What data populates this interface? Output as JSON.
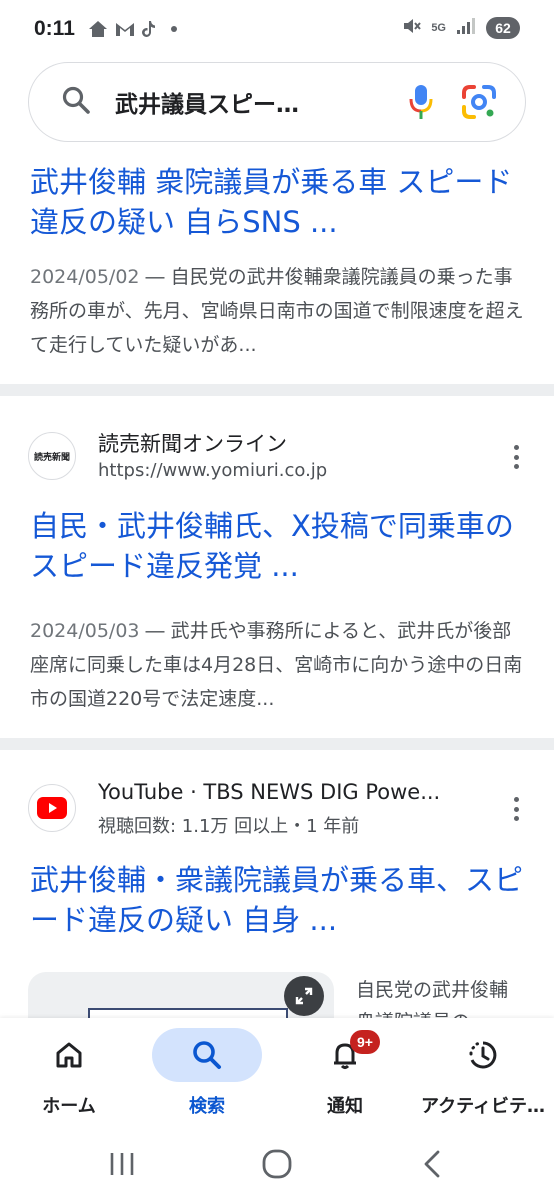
{
  "status_bar": {
    "time": "0:11",
    "network": "5G",
    "battery": "62"
  },
  "search": {
    "query": "武井議員スピー…",
    "icons": [
      "search-icon",
      "mic-icon",
      "lens-icon"
    ]
  },
  "results": [
    {
      "title": "武井俊輔 衆院議員が乗る車 スピード違反の疑い 自らSNS ...",
      "date": "2024/05/02",
      "snippet": " ― 自民党の武井俊輔衆議院議員の乗った事務所の車が、先月、宮崎県日南市の国道で制限速度を超えて走行していた疑いがあ..."
    },
    {
      "site_name": "読売新聞オンライン",
      "site_url": "https://www.yomiuri.co.jp",
      "favicon_text": "読売新聞",
      "title": "自民・武井俊輔氏、X投稿で同乗車のスピード違反発覚 ...",
      "date": "2024/05/03",
      "snippet": " ― 武井氏や事務所によると、武井氏が後部座席に同乗した車は4月28日、宮崎市に向かう途中の日南市の国道220号で法定速度..."
    },
    {
      "site_name": "YouTube · TBS NEWS DIG Powe...",
      "site_meta": "視聴回数: 1.1万 回以上・1 年前",
      "title": "武井俊輔・衆議院議員が乗る車、スピード違反の疑い 自身 ...",
      "side_text": "自民党の武井俊輔衆議院議員の"
    }
  ],
  "bottom_nav": {
    "items": [
      {
        "label": "ホーム",
        "icon": "home-icon"
      },
      {
        "label": "検索",
        "icon": "search-icon"
      },
      {
        "label": "通知",
        "icon": "bell-icon",
        "badge": "9+"
      },
      {
        "label": "アクティビテ…",
        "icon": "activity-icon"
      }
    ],
    "active_index": 1
  },
  "colors": {
    "link": "#1558d6",
    "active_pill": "#d3e3fd",
    "active_label": "#0b57d0",
    "badge": "#c5221f",
    "youtube_red": "#ff0000",
    "separator": "#eceef0"
  }
}
